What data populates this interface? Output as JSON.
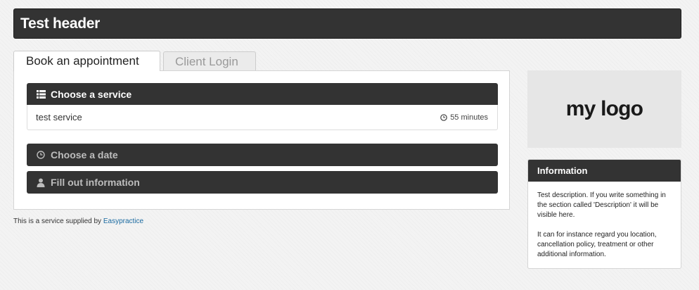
{
  "header": {
    "title": "Test header"
  },
  "tabs": [
    {
      "label": "Book an appointment",
      "active": true
    },
    {
      "label": "Client Login",
      "active": false
    }
  ],
  "booking": {
    "steps": [
      {
        "label": "Choose a service",
        "icon": "list-icon"
      },
      {
        "label": "Choose a date",
        "icon": "clock-icon"
      },
      {
        "label": "Fill out information",
        "icon": "user-icon"
      }
    ],
    "service": {
      "name": "test service",
      "duration": "55 minutes"
    }
  },
  "footer": {
    "text": "This is a service supplied by",
    "link_label": "Easypractice"
  },
  "logo": {
    "text": "my logo"
  },
  "info": {
    "title": "Information",
    "paragraph1": "Test description. If you write something in the section called 'Description' it will be visible here.",
    "paragraph2": "It can for instance regard you location, cancellation policy, treatment or other additional information."
  },
  "colors": {
    "dark": "#333333",
    "link": "#1a6aa0",
    "logo_bg": "#e6e6e6"
  }
}
